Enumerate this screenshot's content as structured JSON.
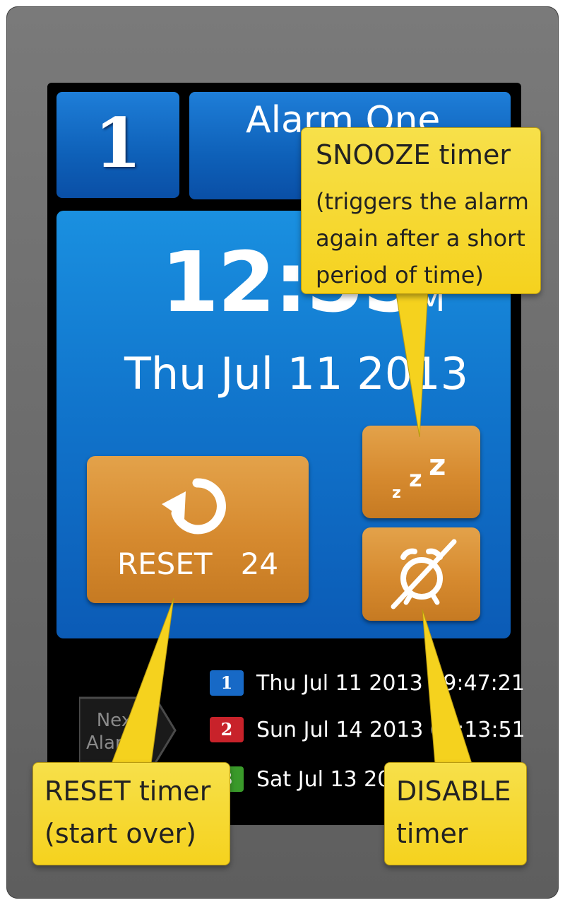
{
  "alarm": {
    "number": "1",
    "name": "Alarm One",
    "time": "12:55",
    "ampm": "PM",
    "date": "Thu Jul 11 2013"
  },
  "buttons": {
    "reset_label": "RESET",
    "reset_count": "24",
    "snooze_icon": "zzz-snooze-icon",
    "disable_icon": "alarm-off-icon"
  },
  "next_alarms": {
    "label_line1": "Next",
    "label_line2": "Alarms",
    "items": [
      {
        "badge": "1",
        "color": "#1769c6",
        "text": "Thu Jul 11 2013 09:47:21"
      },
      {
        "badge": "2",
        "color": "#c8222a",
        "text": "Sun Jul 14 2013 02:13:51"
      },
      {
        "badge": "3",
        "color": "#3a9a2a",
        "text": "Sat Jul 13 2013 ..."
      }
    ]
  },
  "callouts": {
    "snooze_title": "SNOOZE timer",
    "snooze_body": "(triggers the alarm again after a short period of time)",
    "reset_title": "RESET timer",
    "reset_body": "(start over)",
    "disable_title": "DISABLE",
    "disable_body": "timer"
  },
  "colors": {
    "accent_blue": "#1175cc",
    "button_orange": "#d68a2f",
    "callout_yellow": "#f5d21e"
  }
}
